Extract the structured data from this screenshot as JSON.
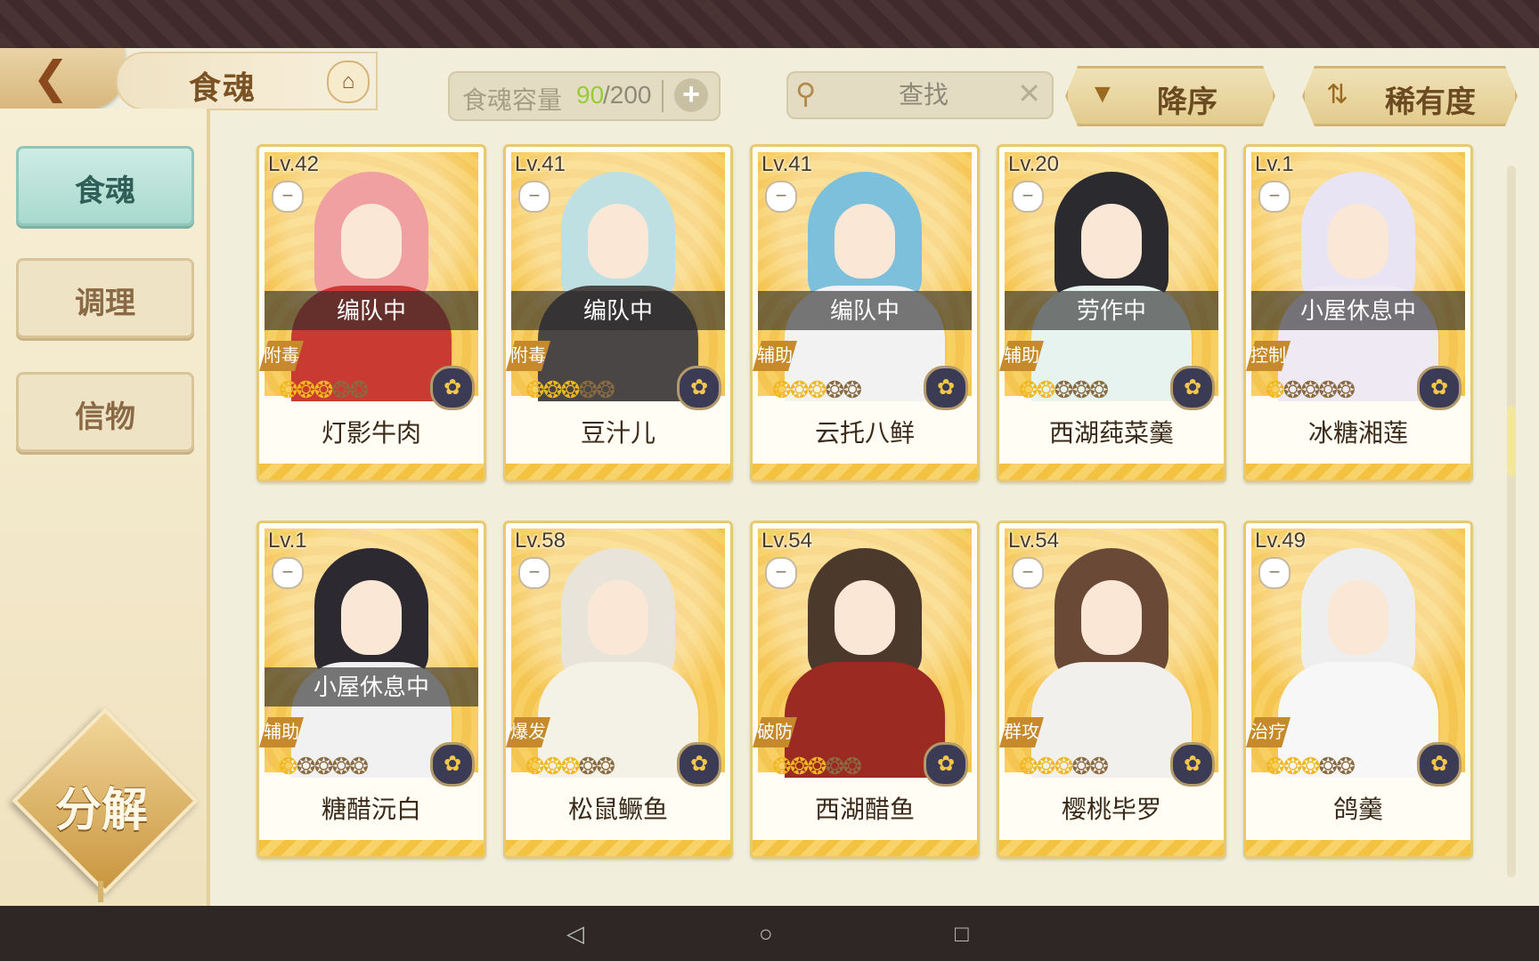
{
  "header": {
    "title": "食魂",
    "capacity_label": "食魂容量",
    "capacity_current": "90",
    "capacity_max": "/200",
    "capacity_add": "+",
    "search_placeholder": "查找",
    "sort_order_label": "降序",
    "sort_field_label": "稀有度"
  },
  "sidebar": {
    "tabs": [
      {
        "label": "食魂",
        "active": true
      },
      {
        "label": "调理",
        "active": false
      },
      {
        "label": "信物",
        "active": false
      }
    ],
    "decompose_label": "分解"
  },
  "colors": {
    "accent_gold": "#e7c96e",
    "active_tab": "#a9d9cd",
    "capacity_current": "#96cc3a",
    "role_badge": "#c68a2c"
  },
  "cards": [
    {
      "level": "Lv.42",
      "status": "编队中",
      "role": "附毒",
      "name": "灯影牛肉",
      "flames_lit": 3,
      "element_icon": "flower-icon",
      "palette": {
        "hair": "#f0a0a0",
        "body": "#c83a32"
      }
    },
    {
      "level": "Lv.41",
      "status": "编队中",
      "role": "附毒",
      "name": "豆汁儿",
      "flames_lit": 3,
      "element_icon": "flower-icon",
      "palette": {
        "hair": "#bfe0e3",
        "body": "#4a4646"
      }
    },
    {
      "level": "Lv.41",
      "status": "编队中",
      "role": "辅助",
      "name": "云托八鲜",
      "flames_lit": 3,
      "element_icon": "flower-icon",
      "palette": {
        "hair": "#7cc0dc",
        "body": "#f2f2f2"
      }
    },
    {
      "level": "Lv.20",
      "status": "劳作中",
      "role": "辅助",
      "name": "西湖莼菜羹",
      "flames_lit": 2,
      "element_icon": "flower-icon",
      "palette": {
        "hair": "#2b2a2e",
        "body": "#e6f3ee"
      }
    },
    {
      "level": "Lv.1",
      "status": "小屋休息中",
      "role": "控制",
      "name": "冰糖湘莲",
      "flames_lit": 1,
      "element_icon": "flower-icon",
      "palette": {
        "hair": "#e9e4f3",
        "body": "#efe9f3"
      }
    },
    {
      "level": "Lv.1",
      "status": "小屋休息中",
      "role": "辅助",
      "name": "糖醋沅白",
      "flames_lit": 1,
      "element_icon": "flower-icon",
      "palette": {
        "hair": "#2c2a30",
        "body": "#f1f1f1"
      }
    },
    {
      "level": "Lv.58",
      "status": "",
      "role": "爆发",
      "name": "松鼠鳜鱼",
      "flames_lit": 3,
      "element_icon": "flower-icon",
      "palette": {
        "hair": "#e8e4da",
        "body": "#f4f1e6"
      }
    },
    {
      "level": "Lv.54",
      "status": "",
      "role": "破防",
      "name": "西湖醋鱼",
      "flames_lit": 3,
      "element_icon": "flower-icon",
      "palette": {
        "hair": "#4b3a2c",
        "body": "#9a2a22"
      }
    },
    {
      "level": "Lv.54",
      "status": "",
      "role": "群攻",
      "name": "樱桃毕罗",
      "flames_lit": 3,
      "element_icon": "flower-icon",
      "palette": {
        "hair": "#6a4a36",
        "body": "#f2f0ec"
      }
    },
    {
      "level": "Lv.49",
      "status": "",
      "role": "治疗",
      "name": "鸽羹",
      "flames_lit": 3,
      "element_icon": "flower-icon",
      "palette": {
        "hair": "#eeeeef",
        "body": "#f7f7f7"
      }
    }
  ],
  "system_nav": {
    "back": "◁",
    "home": "○",
    "recents": "□"
  }
}
